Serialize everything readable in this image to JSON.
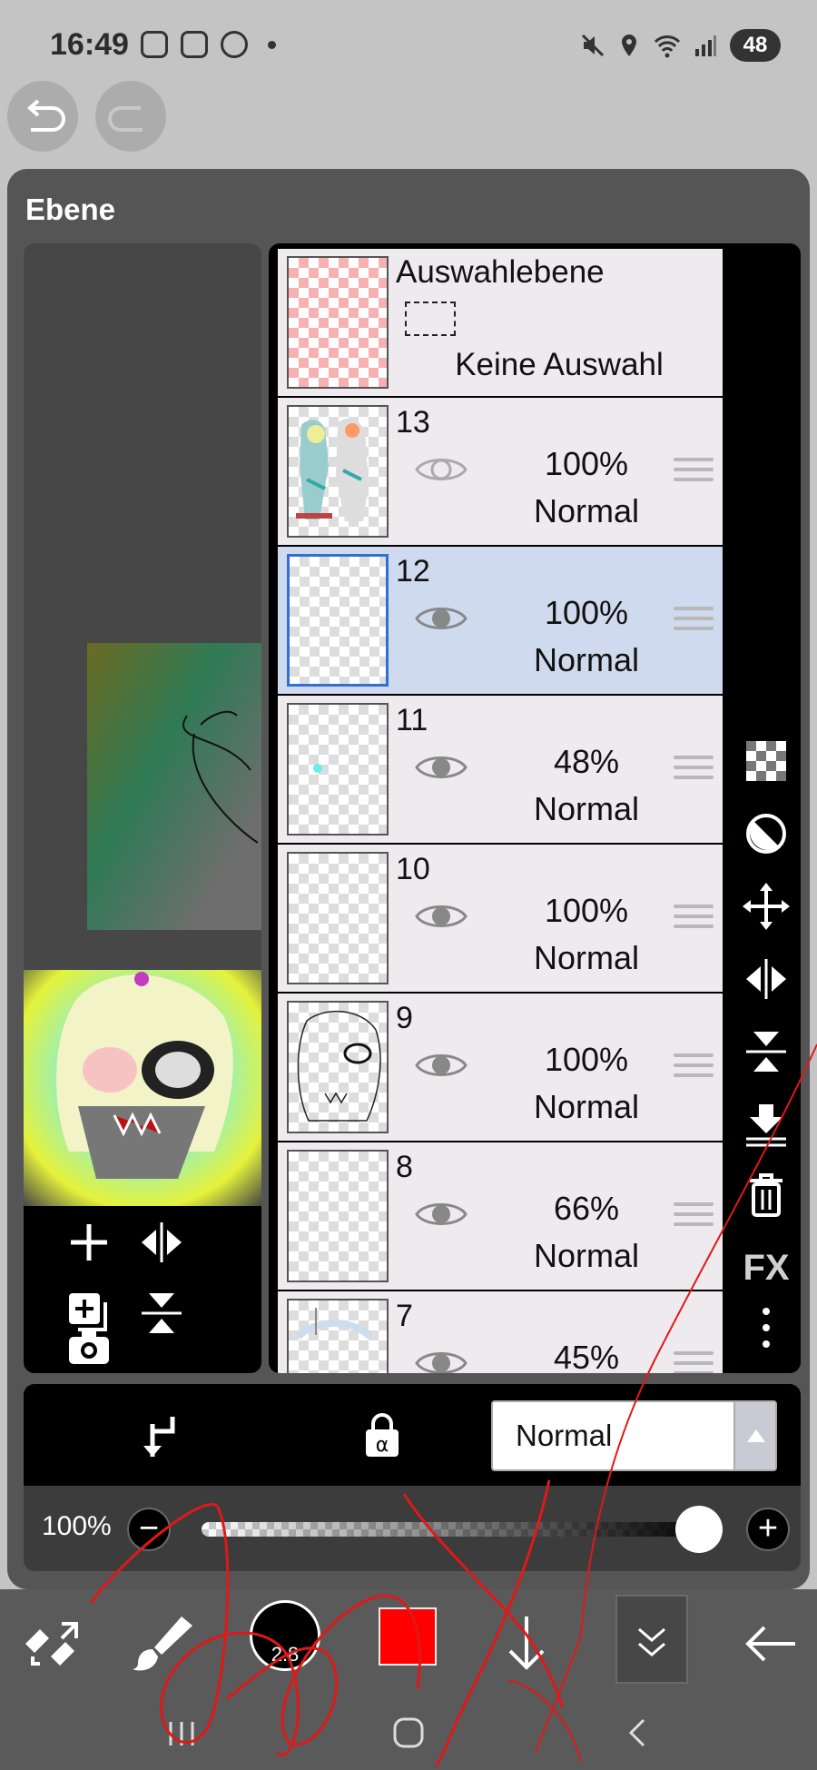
{
  "status_bar": {
    "time": "16:49",
    "battery": "48"
  },
  "dialog": {
    "title": "Ebene"
  },
  "selection_layer": {
    "title": "Auswahlebene",
    "status": "Keine Auswahl"
  },
  "layers": [
    {
      "number": "13",
      "opacity": "100%",
      "mode": "Normal",
      "visible": true
    },
    {
      "number": "12",
      "opacity": "100%",
      "mode": "Normal",
      "visible": true,
      "selected": true
    },
    {
      "number": "11",
      "opacity": "48%",
      "mode": "Normal",
      "visible": true
    },
    {
      "number": "10",
      "opacity": "100%",
      "mode": "Normal",
      "visible": true
    },
    {
      "number": "9",
      "opacity": "100%",
      "mode": "Normal",
      "visible": true
    },
    {
      "number": "8",
      "opacity": "66%",
      "mode": "Normal",
      "visible": true
    },
    {
      "number": "7",
      "opacity": "45%",
      "mode": "",
      "visible": true
    }
  ],
  "side_tools": {
    "fx_label": "FX"
  },
  "bottom_bar": {
    "blend_mode": "Normal"
  },
  "opacity_slider": {
    "label": "100%",
    "value": 1.0
  },
  "toolbar": {
    "brush_size": "2.8",
    "color": "#ff0000"
  }
}
